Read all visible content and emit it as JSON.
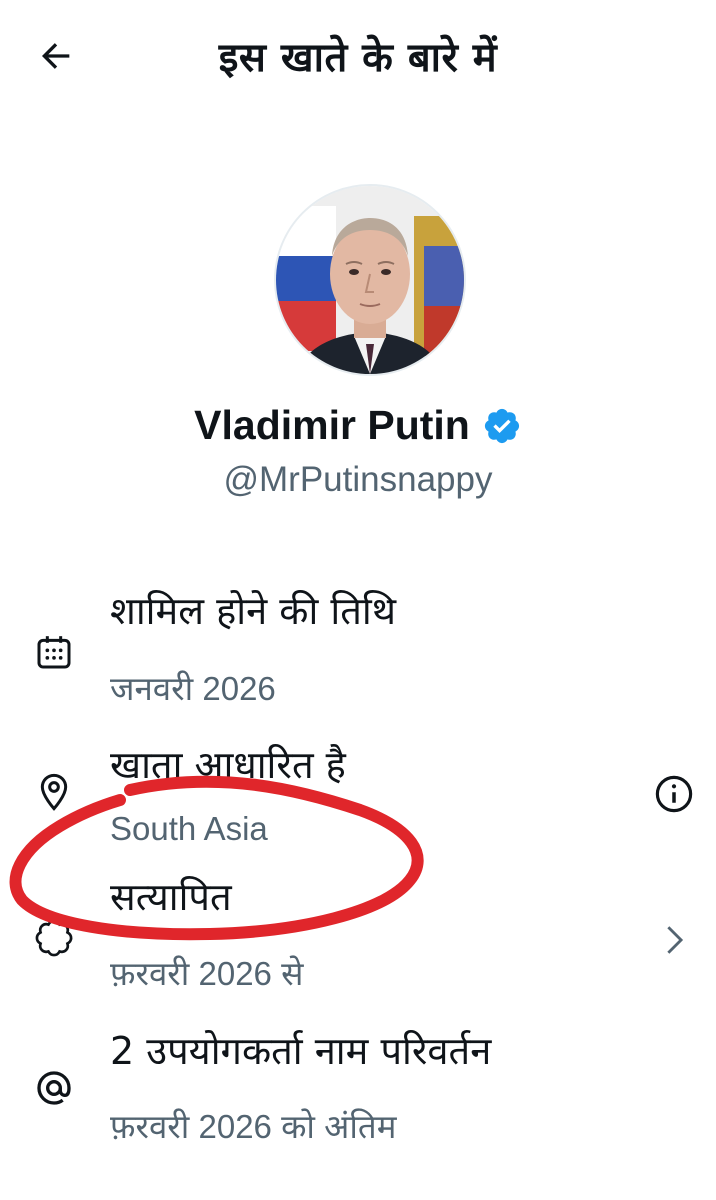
{
  "header": {
    "title": "इस खाते के बारे में",
    "back_icon": "arrow-left-icon"
  },
  "profile": {
    "name": "Vladimir Putin",
    "handle": "@MrPutinsnappy",
    "verified_icon": "verified-badge-icon",
    "verified_color": "#1d9bf0"
  },
  "items": [
    {
      "icon": "calendar-icon",
      "title": "शामिल होने की तिथि",
      "subtitle": "जनवरी 2026"
    },
    {
      "icon": "location-pin-icon",
      "title": "खाता आधारित है",
      "subtitle": "South Asia",
      "right_icon": "info-icon"
    },
    {
      "icon": "verified-badge-icon",
      "title": "सत्यापित",
      "subtitle": "फ़रवरी 2026 से",
      "right_icon": "chevron-right-icon"
    },
    {
      "icon": "at-sign-icon",
      "title": "2 उपयोगकर्ता नाम परिवर्तन",
      "subtitle": "फ़रवरी 2026 को अंतिम"
    }
  ],
  "colors": {
    "text": "#0f1419",
    "secondary": "#536471",
    "annotation": "#e0262b"
  }
}
